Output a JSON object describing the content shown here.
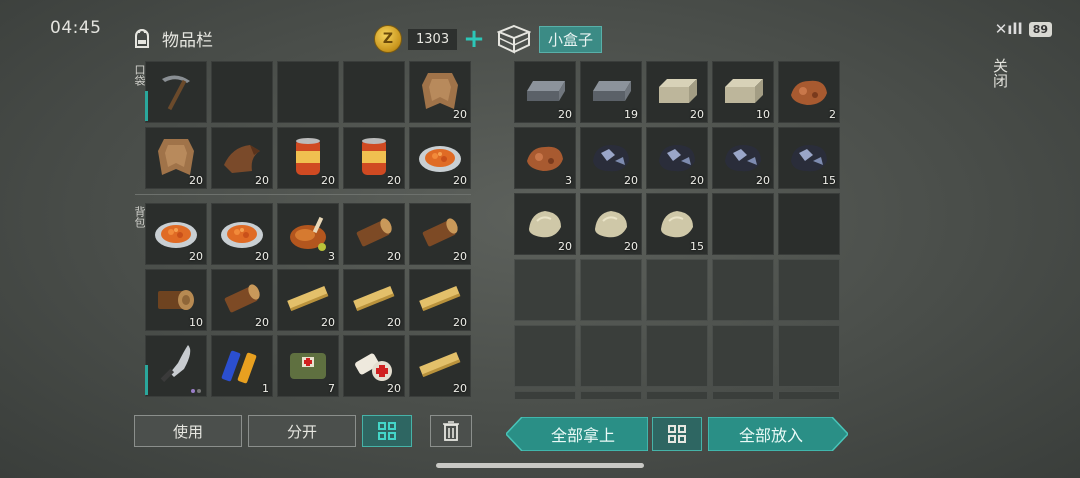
{
  "status": {
    "time": "04:45",
    "battery": "89"
  },
  "close_label": "关闭",
  "inventory": {
    "title": "物品栏",
    "coins": "1303",
    "coin_letter": "Z",
    "pocket_label": "口袋",
    "backpack_label": "背包",
    "pocket": [
      {
        "icon": "pickaxe-icon",
        "count": ""
      },
      {
        "icon": "",
        "count": ""
      },
      {
        "icon": "",
        "count": ""
      },
      {
        "icon": "",
        "count": ""
      },
      {
        "icon": "hide-icon",
        "count": "20"
      },
      {
        "icon": "hide-icon",
        "count": "20"
      },
      {
        "icon": "leather-icon",
        "count": "20"
      },
      {
        "icon": "canned-food-icon",
        "count": "20"
      },
      {
        "icon": "canned-food-icon",
        "count": "20"
      },
      {
        "icon": "stew-plate-icon",
        "count": "20"
      }
    ],
    "backpack": [
      {
        "icon": "stew-plate-icon",
        "count": "20"
      },
      {
        "icon": "stew-plate-icon",
        "count": "20"
      },
      {
        "icon": "roast-chicken-icon",
        "count": "3"
      },
      {
        "icon": "log-icon",
        "count": "20"
      },
      {
        "icon": "log-icon",
        "count": "20"
      },
      {
        "icon": "log-end-icon",
        "count": "10"
      },
      {
        "icon": "log-icon",
        "count": "20"
      },
      {
        "icon": "plank-icon",
        "count": "20"
      },
      {
        "icon": "plank-icon",
        "count": "20"
      },
      {
        "icon": "plank-icon",
        "count": "20"
      },
      {
        "icon": "machete-icon",
        "count": ""
      },
      {
        "icon": "battery-icon",
        "count": "1"
      },
      {
        "icon": "medkit-icon",
        "count": "7"
      },
      {
        "icon": "bandage-icon",
        "count": "20"
      },
      {
        "icon": "plank-icon",
        "count": "20"
      }
    ],
    "buttons": {
      "use": "使用",
      "split": "分开"
    }
  },
  "container": {
    "title": "小盒子",
    "items": [
      {
        "icon": "iron-ingot-icon",
        "count": "20"
      },
      {
        "icon": "iron-ingot-icon",
        "count": "19"
      },
      {
        "icon": "stone-block-icon",
        "count": "20"
      },
      {
        "icon": "stone-block-icon",
        "count": "10"
      },
      {
        "icon": "copper-ore-icon",
        "count": "2"
      },
      {
        "icon": "copper-ore-icon",
        "count": "3"
      },
      {
        "icon": "coal-ore-icon",
        "count": "20"
      },
      {
        "icon": "coal-ore-icon",
        "count": "20"
      },
      {
        "icon": "coal-ore-icon",
        "count": "20"
      },
      {
        "icon": "coal-ore-icon",
        "count": "15"
      },
      {
        "icon": "stone-icon",
        "count": "20"
      },
      {
        "icon": "stone-icon",
        "count": "20"
      },
      {
        "icon": "stone-icon",
        "count": "15"
      },
      {
        "icon": "",
        "count": ""
      },
      {
        "icon": "",
        "count": ""
      }
    ],
    "empty_rows": 3,
    "buttons": {
      "take_all": "全部拿上",
      "put_all": "全部放入"
    }
  }
}
